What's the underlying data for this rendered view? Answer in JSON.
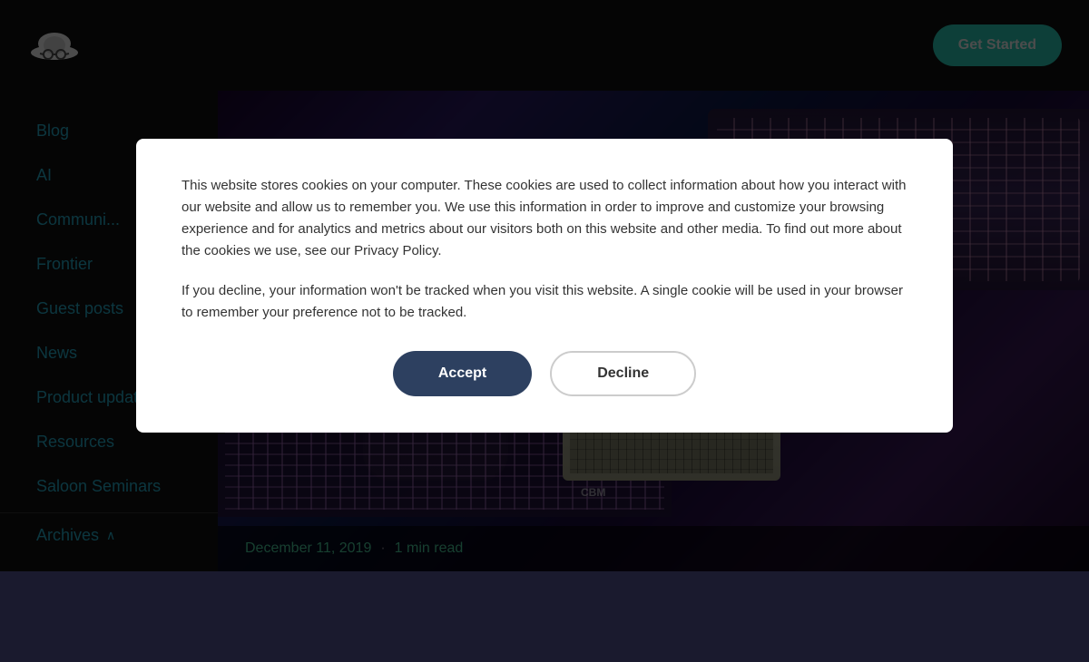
{
  "header": {
    "logo_alt": "Logo",
    "get_started_label": "Get Started"
  },
  "sidebar": {
    "items": [
      {
        "id": "blog",
        "label": "Blog"
      },
      {
        "id": "ai",
        "label": "AI"
      },
      {
        "id": "community",
        "label": "Communi..."
      },
      {
        "id": "frontier",
        "label": "Frontier"
      },
      {
        "id": "guest-posts",
        "label": "Guest posts"
      },
      {
        "id": "news",
        "label": "News"
      },
      {
        "id": "product-updates",
        "label": "Product updates"
      },
      {
        "id": "resources",
        "label": "Resources"
      },
      {
        "id": "saloon-seminars",
        "label": "Saloon Seminars"
      }
    ],
    "archives_label": "Archives",
    "archives_chevron": "∧"
  },
  "hero": {
    "date": "December 11, 2019",
    "separator": "·",
    "read_time": "1 min read"
  },
  "cookie": {
    "text1": "This website stores cookies on your computer. These cookies are used to collect information about how you interact with our website and allow us to remember you. We use this information in order to improve and customize your browsing experience and for analytics and metrics about our visitors both on this website and other media. To find out more about the cookies we use, see our Privacy Policy.",
    "text2": "If you decline, your information won't be tracked when you visit this website. A single cookie will be used in your browser to remember your preference not to be tracked.",
    "accept_label": "Accept",
    "decline_label": "Decline"
  }
}
